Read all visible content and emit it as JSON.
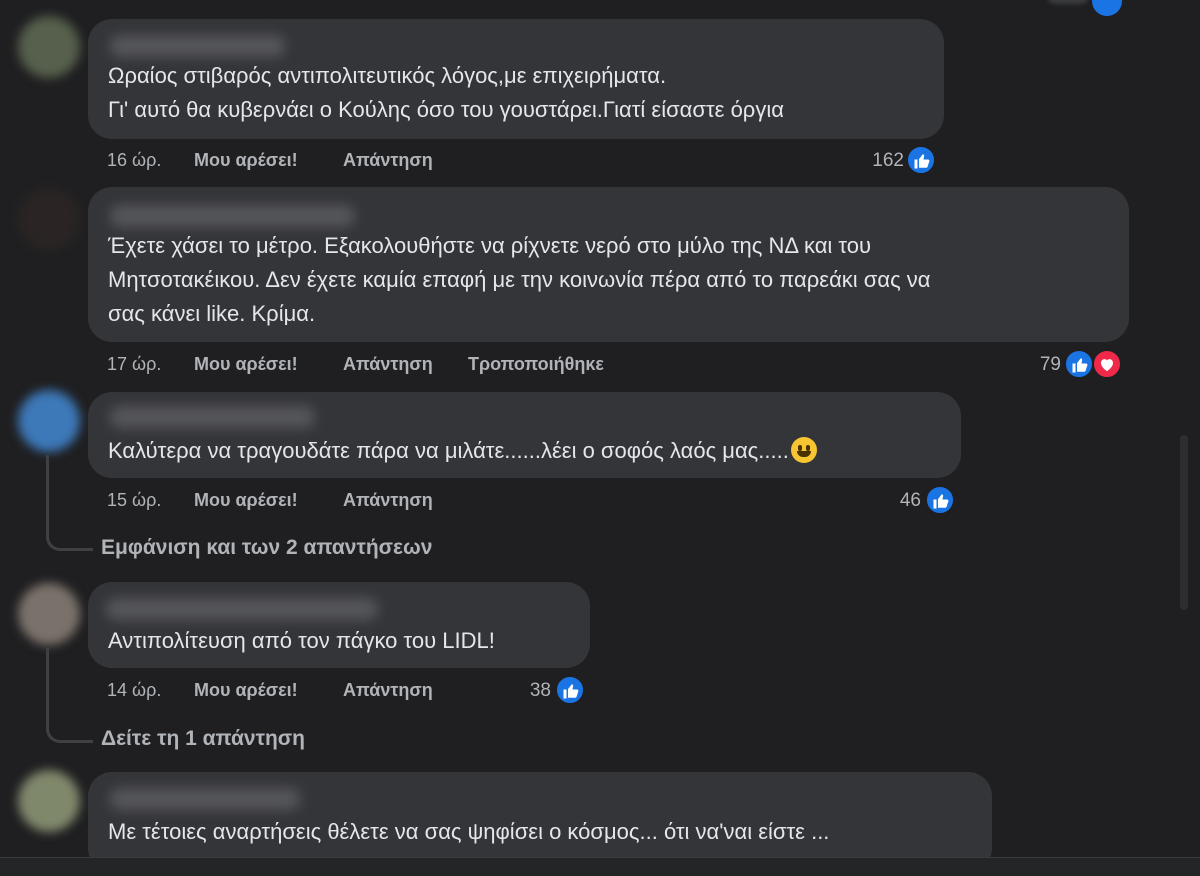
{
  "actions": {
    "like": "Μου αρέσει!",
    "reply": "Απάντηση"
  },
  "comments": [
    {
      "lines": [
        "Ωραίος στιβαρός αντιπολιτευτικός λόγος,με επιχειρήματα.",
        "Γι' αυτό θα κυβερνάει ο Κούλης όσο του γουστάρει.Γιατί είσαστε όργια"
      ],
      "time": "16 ώρ.",
      "reactions": {
        "count": "162",
        "types": [
          "like-icon"
        ]
      }
    },
    {
      "lines": [
        "Έχετε χάσει το μέτρο. Εξακολουθήστε να ρίχνετε νερό στο μύλο της ΝΔ και του",
        "Μητσοτακέικου. Δεν έχετε καμία επαφή με την κοινωνία πέρα από το παρεάκι σας να",
        "σας κάνει like. Κρίμα."
      ],
      "time": "17 ώρ.",
      "edited": "Τροποποιήθηκε",
      "reactions": {
        "count": "79",
        "types": [
          "like-icon",
          "heart-icon"
        ]
      }
    },
    {
      "lines": [
        "Καλύτερα να τραγουδάτε πάρα να μιλάτε......λέει ο σοφός λαός μας....."
      ],
      "emoji": "grinning-face-emoji",
      "time": "15 ώρ.",
      "reactions": {
        "count": "46",
        "types": [
          "like-icon"
        ]
      },
      "replies_link": "Εμφάνιση και των 2 απαντήσεων"
    },
    {
      "lines": [
        "Αντιπολίτευση από τον πάγκο του LIDL!"
      ],
      "time": "14 ώρ.",
      "reactions": {
        "count": "38",
        "types": [
          "like-icon"
        ]
      },
      "replies_link": "Δείτε τη 1 απάντηση"
    },
    {
      "lines": [
        "Με τέτοιες αναρτήσεις θέλετε να σας ψηφίσει ο κόσμος... ότι να'ναι είστε ..."
      ]
    }
  ],
  "colors": {
    "background": "#1f1f21",
    "bubble": "#343538",
    "like": "#1b74e4",
    "love": "#f02849",
    "meta_text": "#b0b3b8",
    "text": "#e4e6eb"
  }
}
